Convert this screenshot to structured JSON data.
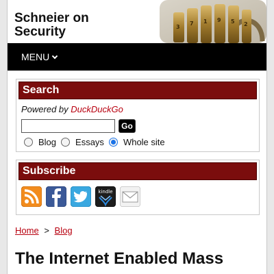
{
  "site": {
    "title_line1": "Schneier on",
    "title_line2": "Security"
  },
  "nav": {
    "menu_label": "MENU"
  },
  "search": {
    "heading": "Search",
    "powered_prefix": "Powered by",
    "powered_link": "DuckDuckGo",
    "input_value": "",
    "go_label": "Go",
    "options": [
      "Blog",
      "Essays",
      "Whole site"
    ],
    "selected": "Whole site"
  },
  "subscribe": {
    "heading": "Subscribe",
    "icons": [
      "rss-icon",
      "facebook-icon",
      "twitter-icon",
      "kindle-icon",
      "email-icon"
    ],
    "kindle_label": "kindle"
  },
  "breadcrumb": {
    "home": "Home",
    "separator": ">",
    "current": "Blog"
  },
  "post": {
    "title": "The Internet Enabled Mass"
  },
  "colors": {
    "accent": "#7b0d0d",
    "link": "#b8000f",
    "nav_bg": "#000000"
  }
}
